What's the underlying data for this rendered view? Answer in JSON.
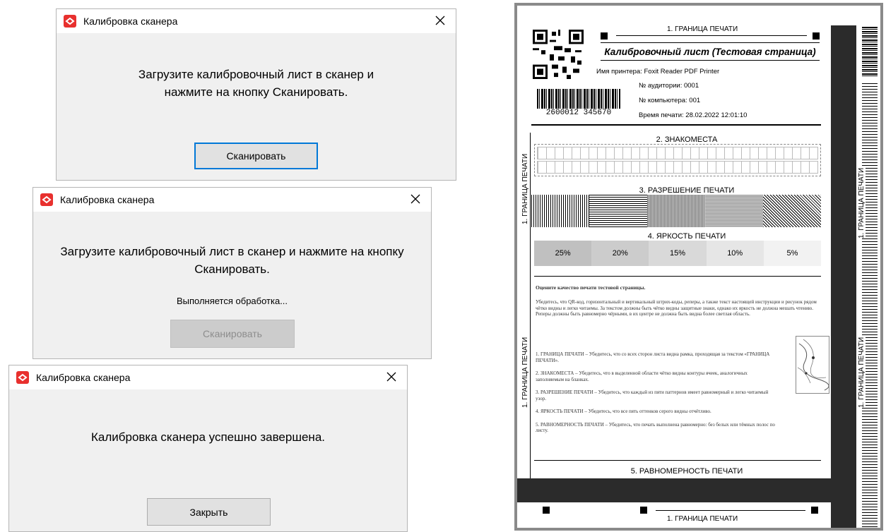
{
  "dialogs": [
    {
      "title": "Калибровка сканера",
      "message": "Загрузите калибровочный лист в сканер и нажмите на кнопку Сканировать.",
      "status": "",
      "button": "Сканировать"
    },
    {
      "title": "Калибровка сканера",
      "message": "Загрузите калибровочный лист в сканер и нажмите на кнопку Сканировать.",
      "status": "Выполняется обработка...",
      "button": "Сканировать"
    },
    {
      "title": "Калибровка сканера",
      "message": "Калибровка сканера успешно завершена.",
      "status": "",
      "button": "Закрыть"
    }
  ],
  "sheet": {
    "border_label": "1. ГРАНИЦА ПЕЧАТИ",
    "title": "Калибровочный лист (Тестовая страница)",
    "printer": "Имя принтера: Foxit Reader PDF Printer",
    "room": "№ аудитории: 0001",
    "computer": "№ компьютера: 001",
    "print_time": "Время печати: 28.02.2022 12:01:10",
    "barcode_number": "2600012 345670",
    "section2": "2. ЗНАКОМЕСТА",
    "section3": "3. РАЗРЕШЕНИЕ ПЕЧАТИ",
    "section4": "4. ЯРКОСТЬ ПЕЧАТИ",
    "section5": "5. РАВНОМЕРНОСТЬ ПЕЧАТИ",
    "brightness": [
      {
        "label": "25%",
        "fill": "#c0c0c0"
      },
      {
        "label": "20%",
        "fill": "#cccccc"
      },
      {
        "label": "15%",
        "fill": "#d9d9d9"
      },
      {
        "label": "10%",
        "fill": "#e6e6e6"
      },
      {
        "label": "5%",
        "fill": "#f2f2f2"
      }
    ],
    "instructions_heading": "Оцените качество печати тестовой страницы.",
    "instructions_intro": "Убедитесь, что QR-код, горизонтальный и вертикальный штрих-коды, реперы, а также текст настоящей инструкции и рисунок рядом чётко видны и легко читаемы. За текстом должны быть чётко видны защитные знаки, однако их яркость не должна мешать чтению. Реперы должны быть равномерно чёрными, в их центре не должна быть видна более светлая область.",
    "instructions_items": [
      "1. ГРАНИЦА ПЕЧАТИ – Убедитесь, что со всех сторон листа видна рамка, проходящая за текстом «ГРАНИЦА ПЕЧАТИ».",
      "2. ЗНАКОМЕСТА – Убедитесь, что в выделенной области чётко видны контуры ячеек, аналогичных заполняемым на бланках.",
      "3. РАЗРЕШЕНИЕ ПЕЧАТИ – Убедитесь, что каждый из пяти паттернов имеет равномерный и легко читаемый узор.",
      "4. ЯРКОСТЬ ПЕЧАТИ – Убедитесь, что все пять оттенков серого видны отчётливо.",
      "5. РАВНОМЕРНОСТЬ ПЕЧАТИ – Убедитесь, что печать выполнена равномерно: без белых или тёмных полос по листу."
    ]
  },
  "colors": {
    "accent": "#0078d7",
    "app_icon": "#e8302e",
    "dialog_bg": "#f0f0f0"
  }
}
